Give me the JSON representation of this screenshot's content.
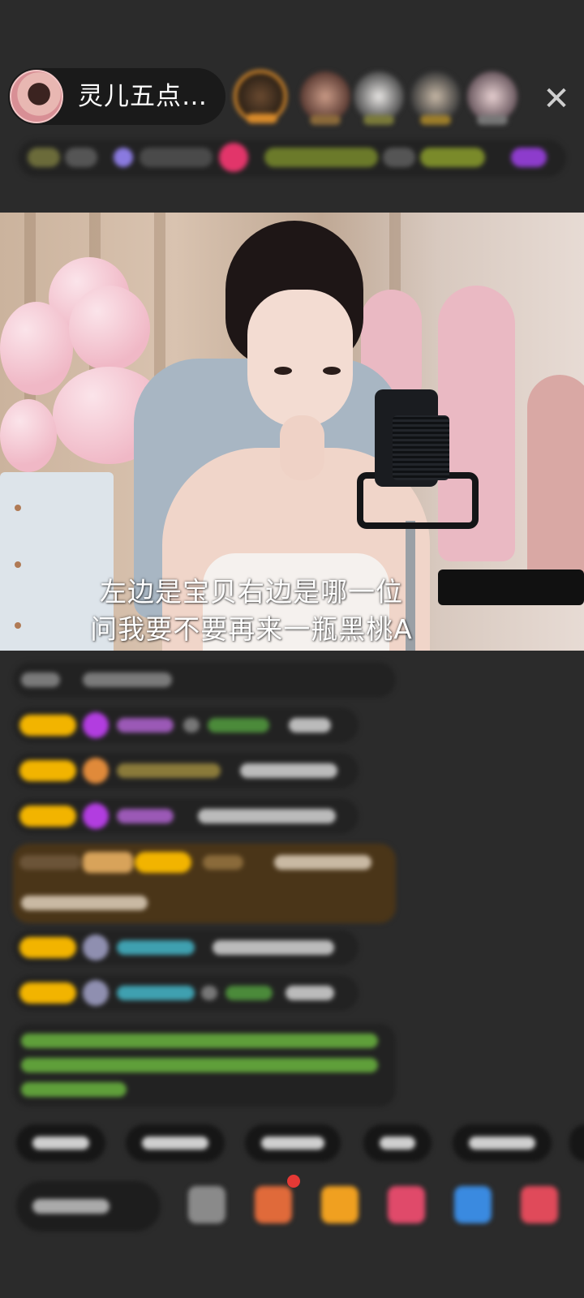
{
  "header": {
    "host_name": "灵儿五点…",
    "close_symbol": "✕"
  },
  "video": {
    "subtitle_line1": "左边是宝贝右边是哪一位",
    "subtitle_line2": "问我要不要再来一瓶黑桃A"
  },
  "colors": {
    "badge_yellow": "#f2b400",
    "purple_gem": "#b23de0",
    "chat_bg": "#222222",
    "highlight_bg": "#4a3518",
    "green_text": "#6fbf3a",
    "cyan_text": "#3fa0b0"
  }
}
